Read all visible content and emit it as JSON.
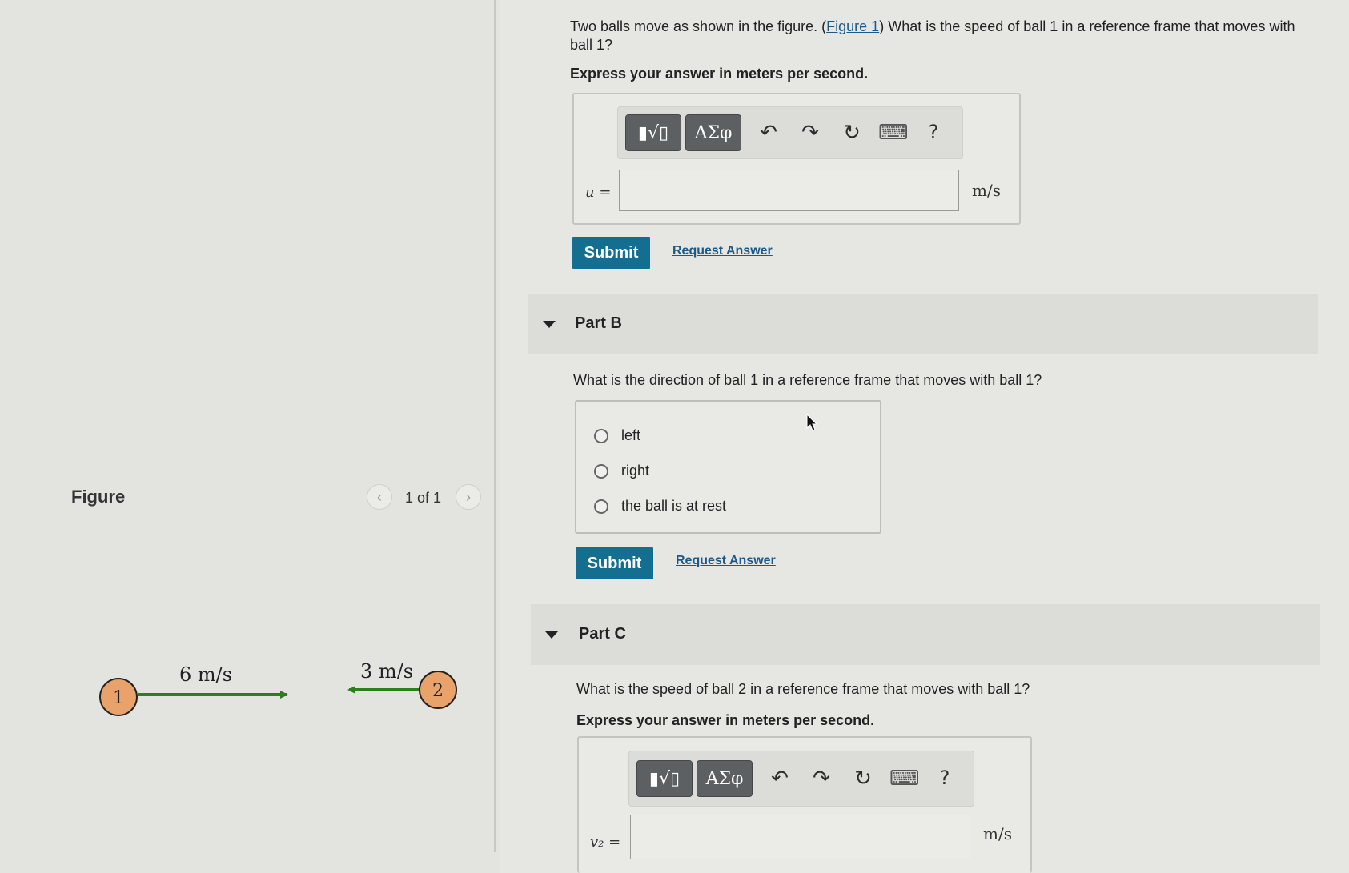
{
  "figure": {
    "title": "Figure",
    "pager": "1 of 1",
    "prev_icon": "chevron-left-icon",
    "next_icon": "chevron-right-icon",
    "ball1_label": "1",
    "ball1_speed": "6 m/s",
    "ball2_label": "2",
    "ball2_speed": "3 m/s",
    "arrow_color": "#2e7d1f",
    "ball_color": "#e9a36a"
  },
  "part_a": {
    "question_pre": "Two balls move as shown in the figure. (",
    "figure_link": "Figure 1",
    "question_post": ") What is the speed of ball 1 in a reference frame that moves with ball 1?",
    "instruction": "Express your answer in meters per second.",
    "var_label": "u =",
    "unit": "m/s",
    "input_value": "",
    "submit_label": "Submit",
    "request_label": "Request Answer"
  },
  "toolbar": {
    "templates_label": "▮√▯",
    "symbols_label": "ΑΣφ",
    "undo_icon": "↶",
    "redo_icon": "↷",
    "reset_icon": "↻",
    "keyboard_icon": "⌨",
    "help_label": "?"
  },
  "part_b": {
    "title": "Part B",
    "question": "What is the direction of ball 1 in a reference frame that moves with ball 1?",
    "options": [
      "left",
      "right",
      "the ball is at rest"
    ],
    "submit_label": "Submit",
    "request_label": "Request Answer"
  },
  "part_c": {
    "title": "Part C",
    "question": "What is the speed of ball 2 in a reference frame that moves with ball 1?",
    "instruction": "Express your answer in meters per second.",
    "var_label": "v₂ =",
    "unit": "m/s",
    "input_value": ""
  }
}
